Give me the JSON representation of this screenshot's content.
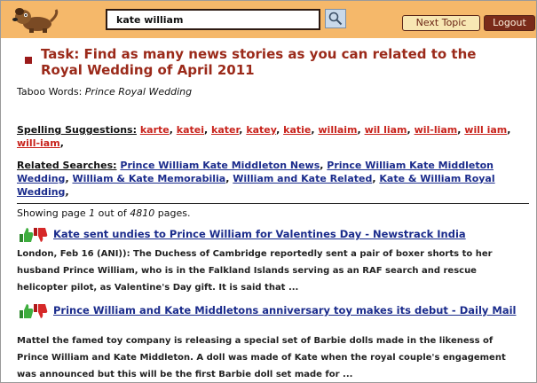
{
  "header": {
    "search_value": "kate william",
    "next_topic_label": "Next Topic",
    "logout_label": "Logout",
    "logo_icon": "dog-mascot-icon",
    "search_icon": "magnifier-icon"
  },
  "task": {
    "title": "Task: Find as many news stories as you can related to the Royal Wedding of April 2011"
  },
  "taboo": {
    "label": "Taboo Words:",
    "words": "Prince Royal Wedding"
  },
  "spelling": {
    "label": "Spelling Suggestions:",
    "items": [
      "karte",
      "katei",
      "kater",
      "katey",
      "katie",
      "willaim",
      "wil liam",
      "wil-liam",
      "will iam",
      "will-iam"
    ]
  },
  "related": {
    "label": "Related Searches:",
    "items": [
      "Prince William Kate Middleton News",
      "Prince William Kate Middleton Wedding",
      "William & Kate Memorabilia",
      "William and Kate Related",
      "Kate & William Royal Wedding"
    ]
  },
  "paging": {
    "prefix": "Showing page",
    "page": "1",
    "middle": "out of",
    "total": "4810",
    "suffix": "pages."
  },
  "results": [
    {
      "title": "Kate sent undies to Prince William for Valentines Day - Newstrack India",
      "snippet": "London, Feb 16 (ANI)): The Duchess of Cambridge reportedly sent a pair of boxer shorts to her husband Prince William, who is in the Falkland Islands serving as an RAF search and rescue helicopter pilot, as Valentine's Day gift. It is said that ..."
    },
    {
      "title": "Prince William and Kate Middletons anniversary toy makes its debut - Daily Mail",
      "snippet": "Mattel the famed toy company is releasing a special set of Barbie dolls made in the likeness of Prince William and Kate Middleton. A doll was made of Kate when the royal couple's engagement was announced but this will be the first Barbie doll set made for ..."
    }
  ],
  "colors": {
    "header_bg": "#f5b86a",
    "task_red": "#9b2a1a",
    "link_red": "#c8231c",
    "link_blue": "#1b2c8c",
    "logout_bg": "#7a2b19"
  }
}
